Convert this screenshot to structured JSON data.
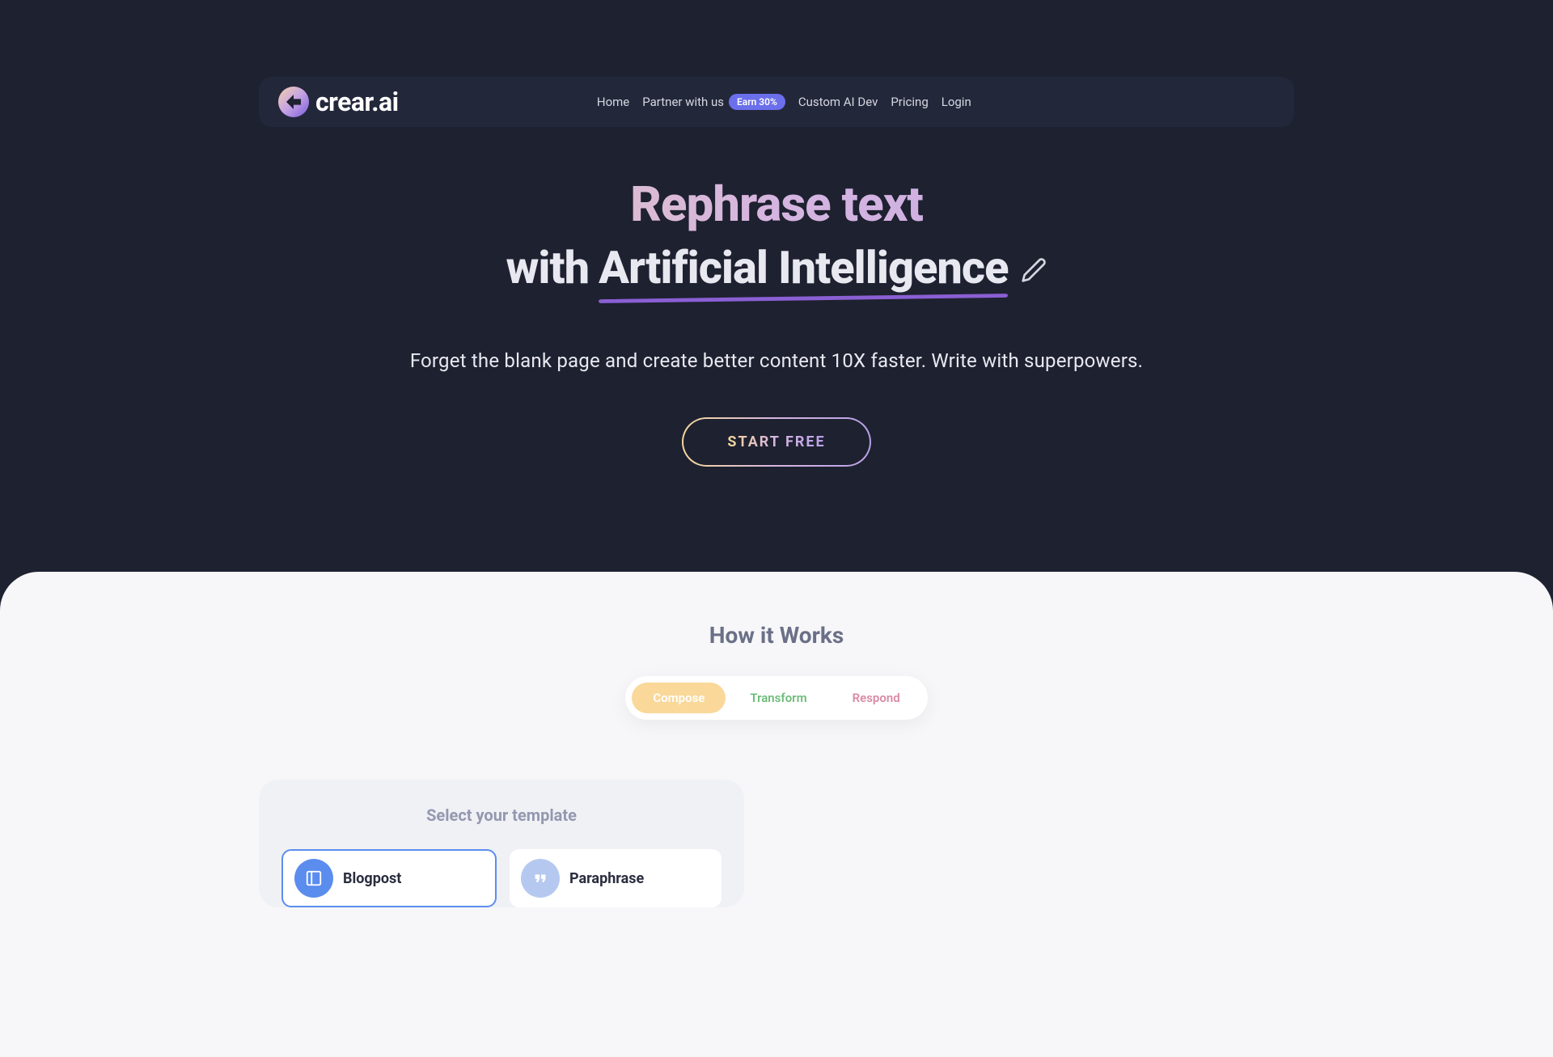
{
  "brand": {
    "name": "crear.ai"
  },
  "nav": {
    "home": "Home",
    "partner": "Partner with us",
    "partner_badge": "Earn 30%",
    "custom_ai": "Custom AI Dev",
    "pricing": "Pricing",
    "login": "Login"
  },
  "hero": {
    "title_line1": "Rephrase text",
    "title_line2_prefix": "with",
    "title_line2_highlight": "Artificial Intelligence",
    "subtitle": "Forget the blank page and create better content 10X faster. Write with superpowers.",
    "cta": "START FREE"
  },
  "how": {
    "title": "How it Works",
    "tabs": {
      "compose": "Compose",
      "transform": "Transform",
      "respond": "Respond"
    }
  },
  "templates": {
    "title": "Select your template",
    "options": [
      {
        "label": "Blogpost"
      },
      {
        "label": "Paraphrase"
      }
    ]
  },
  "colors": {
    "bg_dark": "#1e2130",
    "nav_bg": "#23273a",
    "gradient_start": "#f5d79a",
    "gradient_mid": "#d5b5e0",
    "gradient_end": "#b8a0e8",
    "underline": "#8a5fd4",
    "light_bg": "#f7f7f9",
    "tab_compose_bg": "#f9d89a",
    "tab_transform": "#6dbd7a",
    "tab_respond": "#d98aa5",
    "badge_bg": "#6b6feb",
    "icon_blue": "#5b8def",
    "icon_light": "#b5c9f0",
    "border_selected": "#5b8def"
  }
}
